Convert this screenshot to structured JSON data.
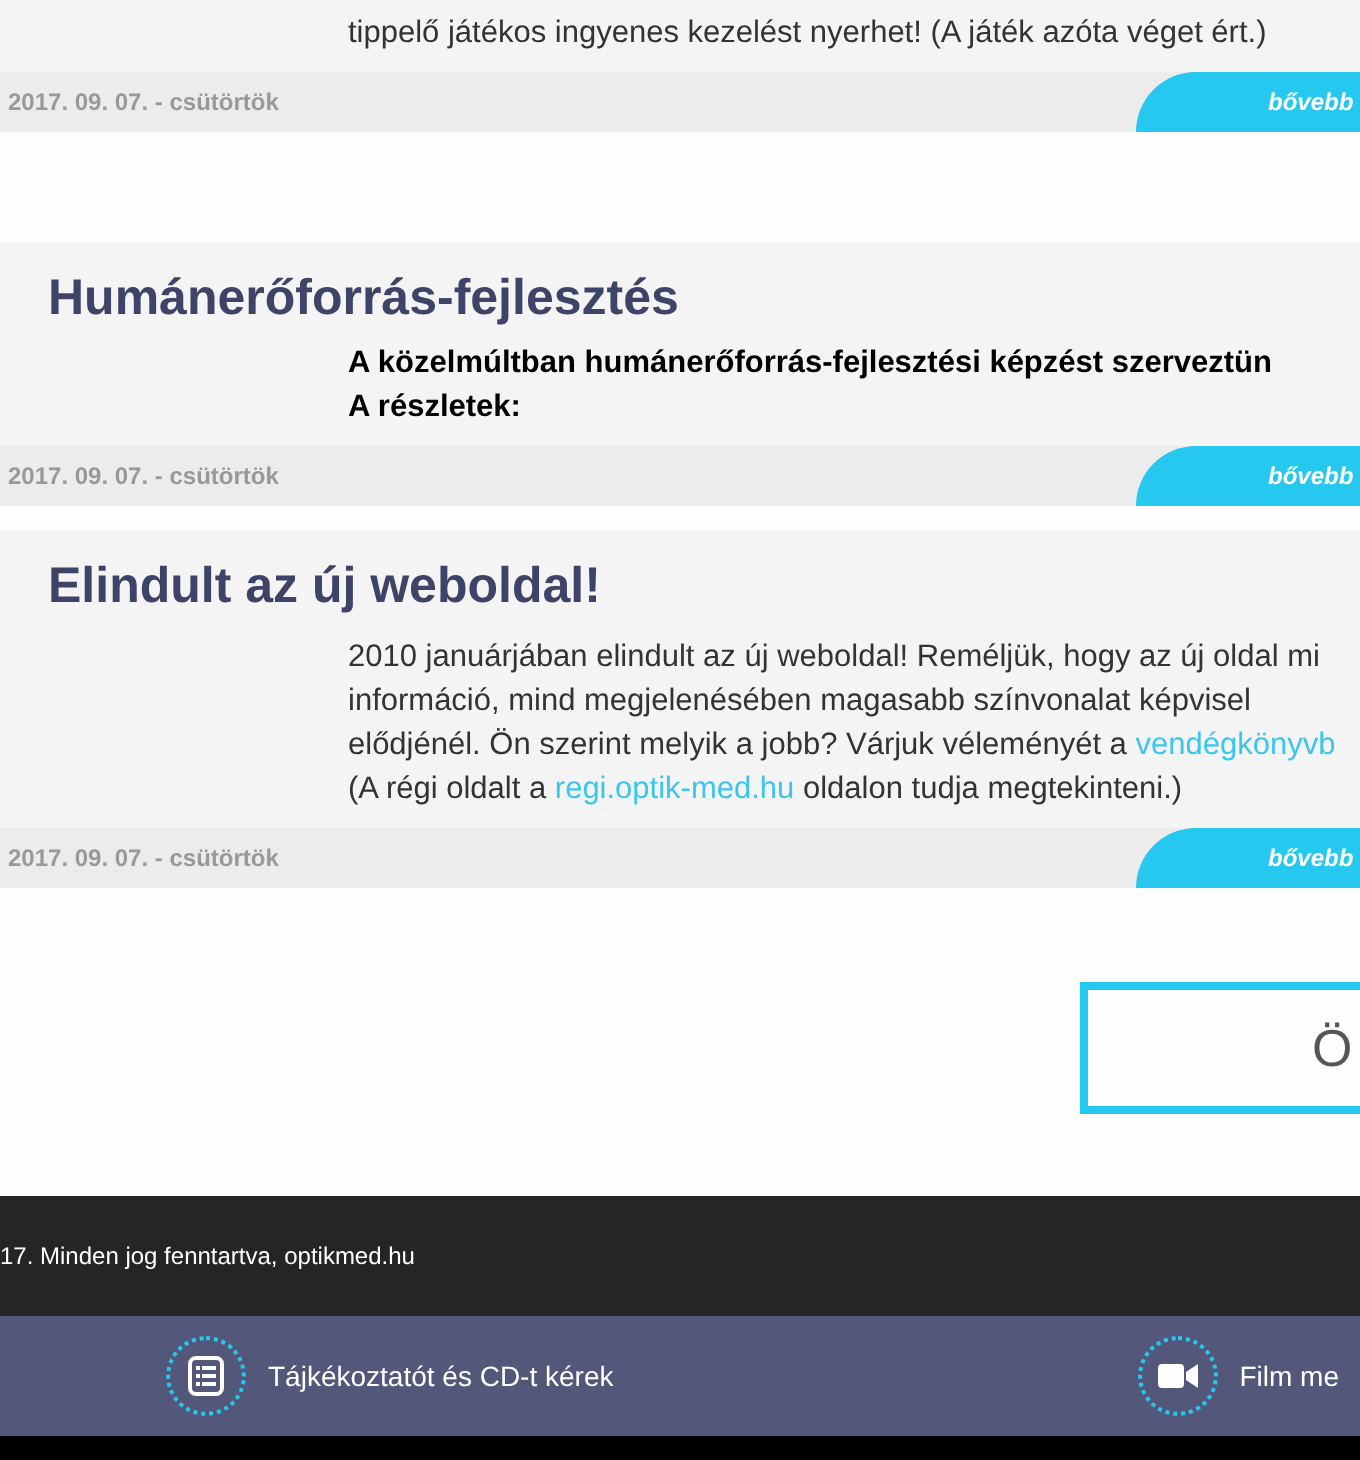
{
  "posts": [
    {
      "lines": [
        [
          {
            "text": "tippelő játékos ingyenes kezelést nyerhet! (A játék azóta véget ért.)"
          }
        ]
      ],
      "bold": false,
      "date": "2017. 09. 07. - csütörtök",
      "more": "bővebb"
    },
    {
      "title": "Humánerőforrás-fejlesztés",
      "lines": [
        [
          {
            "text": "A közelmúltban humánerőforrás-fejlesztési képzést szerveztün"
          }
        ],
        [
          {
            "text": "A részletek:"
          }
        ]
      ],
      "bold": true,
      "date": "2017. 09. 07. - csütörtök",
      "more": "bővebb"
    },
    {
      "title": "Elindult az új weboldal!",
      "lines": [
        [
          {
            "text": "2010 januárjában elindult az új weboldal! Reméljük, hogy az új oldal mi"
          }
        ],
        [
          {
            "text": "információ, mind megjelenésében magasabb színvonalat képvisel"
          }
        ],
        [
          {
            "text": "elődjénél. Ön szerint melyik a jobb? Várjuk véleményét a "
          },
          {
            "text": "vendégkönyvb",
            "link": true
          }
        ],
        [
          {
            "text": "(A régi oldalt a "
          },
          {
            "text": "regi.optik-med.hu",
            "link": true
          },
          {
            "text": " oldalon tudja megtekinteni.)"
          }
        ]
      ],
      "bold": false,
      "date": "2017. 09. 07. - csütörtök",
      "more": "bővebb"
    }
  ],
  "button": {
    "label": "Ö"
  },
  "copyright": "17. Minden jog fenntartva, optikmed.hu",
  "bottom_bar": [
    {
      "kind": "list",
      "label": "Tájkékoztatót és CD-t kérek"
    },
    {
      "kind": "video",
      "label": "Film me"
    }
  ]
}
